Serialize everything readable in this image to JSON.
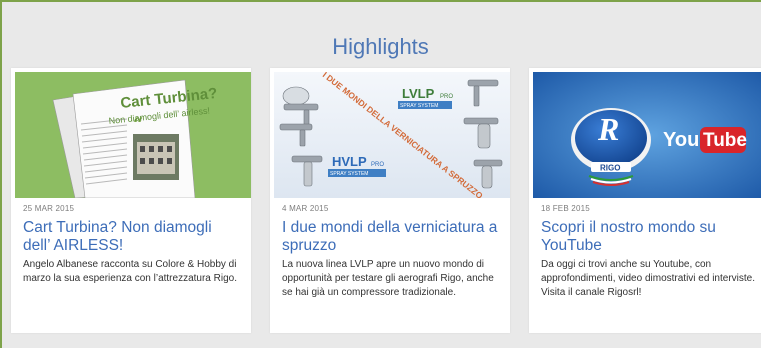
{
  "section": {
    "title": "Highlights"
  },
  "cards": [
    {
      "date": "25 MAR 2015",
      "title": "Cart Turbina? Non diamogli dell’ AIRLESS!",
      "desc": "Angelo Albanese racconta su Colore & Hobby di marzo la sua esperienza con l’attrezzatura Rigo.",
      "image": {
        "headline_1": "Cart Turbina?",
        "headline_2": "Non diamogli dell’ airless!",
        "bg_color": "#8dbd62"
      }
    },
    {
      "date": "4 MAR 2015",
      "title": "I due mondi della verniciatura a spruzzo",
      "desc": "La nuova linea LVLP apre un nuovo mondo di opportunità per testare gli aerografi Rigo, anche se hai già un compressore tradizionale.",
      "image": {
        "lvlp": "LVLP",
        "hvlp": "HVLP",
        "pro": "PRO",
        "spray_system": "SPRAY SYSTEM",
        "diagonal_text": "I DUE MONDI DELLA VERNICIATURA A SPRUZZO"
      }
    },
    {
      "date": "18 FEB 2015",
      "title": "Scopri il nostro mondo su YouTube",
      "desc": "Da oggi ci trovi anche su Youtube, con approfondimenti, video dimostrativi ed interviste. Visita il canale Rigosrl!",
      "image": {
        "brand": "RIGO",
        "you": "You",
        "tube": "Tube"
      }
    }
  ],
  "colors": {
    "accent": "#3d6db8",
    "frame": "#7ea34a",
    "background": "#e9e9e9"
  }
}
